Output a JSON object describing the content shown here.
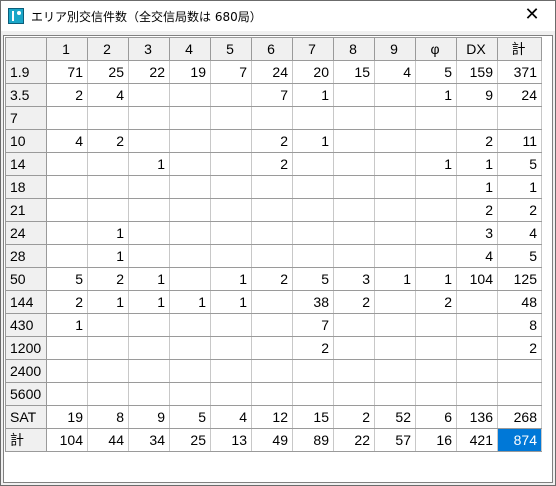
{
  "window": {
    "title": "エリア別交信件数（全交信局数は 680局）",
    "close_label": "✕"
  },
  "grid": {
    "columns": [
      "1",
      "2",
      "3",
      "4",
      "5",
      "6",
      "7",
      "8",
      "9",
      "φ",
      "DX",
      "計"
    ],
    "rows": [
      {
        "label": "1.9",
        "cells": [
          "71",
          "25",
          "22",
          "19",
          "7",
          "24",
          "20",
          "15",
          "4",
          "5",
          "159",
          "371"
        ]
      },
      {
        "label": "3.5",
        "cells": [
          "2",
          "4",
          "",
          "",
          "",
          "7",
          "1",
          "",
          "",
          "1",
          "9",
          "24"
        ]
      },
      {
        "label": "7",
        "cells": [
          "",
          "",
          "",
          "",
          "",
          "",
          "",
          "",
          "",
          "",
          "",
          ""
        ]
      },
      {
        "label": "10",
        "cells": [
          "4",
          "2",
          "",
          "",
          "",
          "2",
          "1",
          "",
          "",
          "",
          "2",
          "11"
        ]
      },
      {
        "label": "14",
        "cells": [
          "",
          "",
          "1",
          "",
          "",
          "2",
          "",
          "",
          "",
          "1",
          "1",
          "5"
        ]
      },
      {
        "label": "18",
        "cells": [
          "",
          "",
          "",
          "",
          "",
          "",
          "",
          "",
          "",
          "",
          "1",
          "1"
        ]
      },
      {
        "label": "21",
        "cells": [
          "",
          "",
          "",
          "",
          "",
          "",
          "",
          "",
          "",
          "",
          "2",
          "2"
        ]
      },
      {
        "label": "24",
        "cells": [
          "",
          "1",
          "",
          "",
          "",
          "",
          "",
          "",
          "",
          "",
          "3",
          "4"
        ]
      },
      {
        "label": "28",
        "cells": [
          "",
          "1",
          "",
          "",
          "",
          "",
          "",
          "",
          "",
          "",
          "4",
          "5"
        ]
      },
      {
        "label": "50",
        "cells": [
          "5",
          "2",
          "1",
          "",
          "1",
          "2",
          "5",
          "3",
          "1",
          "1",
          "104",
          "125"
        ]
      },
      {
        "label": "144",
        "cells": [
          "2",
          "1",
          "1",
          "1",
          "1",
          "",
          "38",
          "2",
          "",
          "2",
          "",
          "48"
        ]
      },
      {
        "label": "430",
        "cells": [
          "1",
          "",
          "",
          "",
          "",
          "",
          "7",
          "",
          "",
          "",
          "",
          "8"
        ]
      },
      {
        "label": "1200",
        "cells": [
          "",
          "",
          "",
          "",
          "",
          "",
          "2",
          "",
          "",
          "",
          "",
          "2"
        ]
      },
      {
        "label": "2400",
        "cells": [
          "",
          "",
          "",
          "",
          "",
          "",
          "",
          "",
          "",
          "",
          "",
          ""
        ]
      },
      {
        "label": "5600",
        "cells": [
          "",
          "",
          "",
          "",
          "",
          "",
          "",
          "",
          "",
          "",
          "",
          ""
        ]
      },
      {
        "label": "SAT",
        "cells": [
          "19",
          "8",
          "9",
          "5",
          "4",
          "12",
          "15",
          "2",
          "52",
          "6",
          "136",
          "268"
        ]
      },
      {
        "label": "計",
        "cells": [
          "104",
          "44",
          "34",
          "25",
          "13",
          "49",
          "89",
          "22",
          "57",
          "16",
          "421",
          "874"
        ]
      }
    ],
    "selected_cell": {
      "row": 16,
      "col": 11
    }
  }
}
